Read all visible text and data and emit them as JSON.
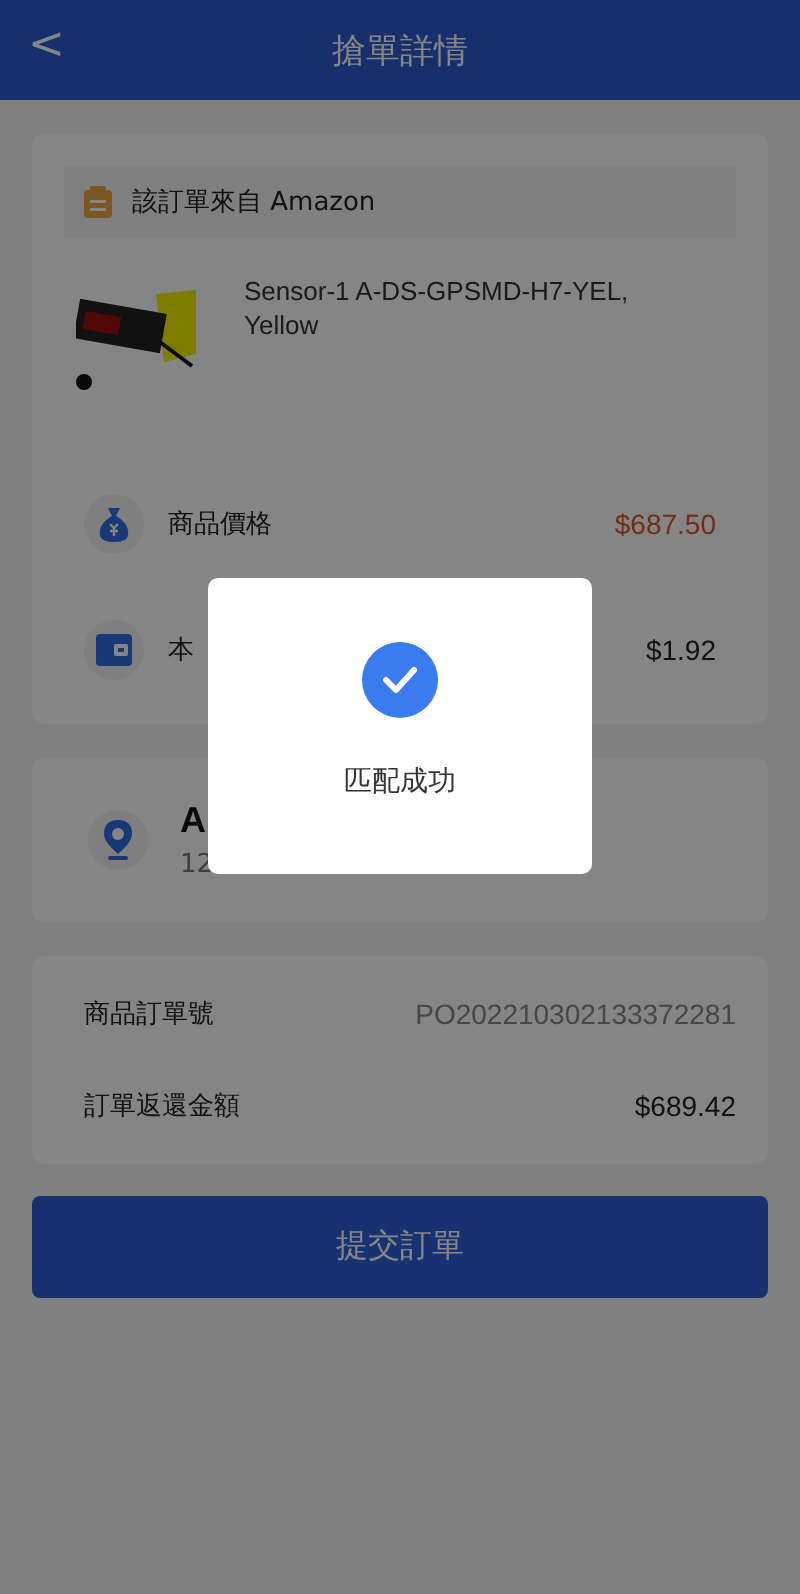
{
  "header": {
    "back_icon": "<",
    "title": "搶單詳情"
  },
  "order_card": {
    "source": "該訂單來自 Amazon",
    "product": {
      "name": "Sensor-1 A-DS-GPSMD-H7-YEL, Yellow"
    },
    "rows": [
      {
        "kind": "price",
        "label": "商品價格",
        "value": "$687.50"
      },
      {
        "kind": "wallet",
        "label": "本",
        "value": "$1.92"
      }
    ]
  },
  "address_card": {
    "name": "A",
    "line": "12"
  },
  "info_card": {
    "rows": [
      {
        "label": "商品訂單號",
        "value": "PO202210302133372281",
        "muted": true
      },
      {
        "label": "訂單返還金額",
        "value": "$689.42",
        "muted": false
      }
    ]
  },
  "submit_button": "提交訂單",
  "dialog": {
    "message": "匹配成功"
  }
}
